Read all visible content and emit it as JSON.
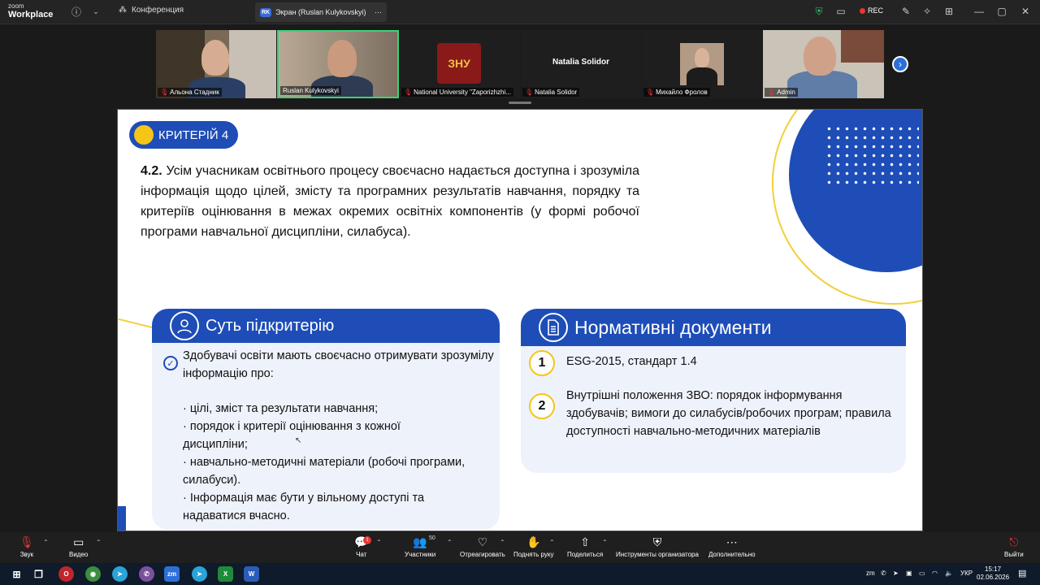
{
  "zoom": {
    "brand_small": "zoom",
    "brand": "Workplace",
    "meeting_menu": "Конференция",
    "share_tab": "Экран (Ruslan Kulykovskyi)",
    "share_initials": "RK",
    "rec": "REC"
  },
  "participants": [
    {
      "name": "Альона Стадник"
    },
    {
      "name": "Ruslan Kulykovskyi"
    },
    {
      "name": "National University \"Zaporizhzhi..."
    },
    {
      "name": "Natalia Solidor",
      "center_name": "Natalia Solidor"
    },
    {
      "name": "Михайло Фролов"
    },
    {
      "name": "Admin"
    }
  ],
  "slide": {
    "badge": "КРИТЕРІЙ 4",
    "criterion_num": "4.2.",
    "criterion_text": " Усім учасникам освітнього процесу своєчасно надається доступна і зрозуміла інформація щодо цілей, змісту та програмних результатів навчання, порядку та критеріїв оцінювання в межах окремих освітніх компонентів (у формі робочої програми навчальної дисципліни, силабуса).",
    "left_title": "Суть підкритерію",
    "left_intro": "Здобувачі освіти мають своєчасно отримувати зрозумілу інформацію про:",
    "left_items": [
      "· цілі, зміст та результати навчання;",
      "· порядок і критерії оцінювання з кожної дисципліни;",
      "· навчально-методичні матеріали (робочі програми, силабуси).",
      "· Інформація має бути у вільному доступі та надаватися вчасно."
    ],
    "right_title": "Нормативні документи",
    "docs": [
      {
        "n": "1",
        "text": "ESG-2015, стандарт 1.4"
      },
      {
        "n": "2",
        "text": "Внутрішні положення ЗВО: порядок інформування здобувачів; вимоги до силабусів/робочих програм; правила доступності навчально-методичних матеріалів"
      }
    ]
  },
  "toolbar": {
    "audio": "Звук",
    "video": "Видео",
    "chat": "Чат",
    "chat_badge": "1",
    "participants": "Участники",
    "participants_count": "50",
    "react": "Отреагировать",
    "raise_hand": "Поднять руку",
    "share": "Поделиться",
    "host_tools": "Инструменты организатора",
    "more": "Дополнительно",
    "leave": "Выйти"
  },
  "taskbar": {
    "lang": "УКР",
    "time": "15:17",
    "date": "02.06.2026"
  },
  "colors": {
    "accent": "#1e4db7",
    "yellow": "#f5c518",
    "leave": "#e33"
  }
}
